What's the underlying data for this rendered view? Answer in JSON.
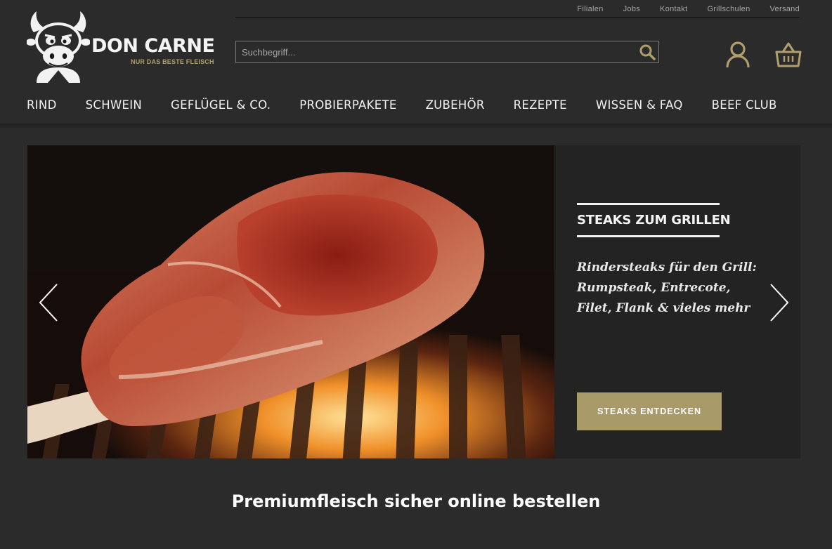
{
  "brand": {
    "name": "DON CARNE",
    "tagline": "NUR DAS BESTE FLEISCH"
  },
  "service_nav": [
    {
      "label": "Filialen"
    },
    {
      "label": "Jobs"
    },
    {
      "label": "Kontakt"
    },
    {
      "label": "Grillschulen"
    },
    {
      "label": "Versand"
    }
  ],
  "search": {
    "placeholder": "Suchbegriff...",
    "value": "",
    "icon": "search-icon"
  },
  "header_icons": {
    "account": "user-icon",
    "cart": "shopping-basket-icon",
    "icon_color": "#b09f6c"
  },
  "main_nav": [
    {
      "label": "RIND"
    },
    {
      "label": "SCHWEIN"
    },
    {
      "label": "GEFLÜGEL & CO."
    },
    {
      "label": "PROBIERPAKETE"
    },
    {
      "label": "ZUBEHÖR"
    },
    {
      "label": "REZEPTE"
    },
    {
      "label": "WISSEN & FAQ"
    },
    {
      "label": "BEEF CLUB"
    }
  ],
  "slider": {
    "slide": {
      "image": "grilled-tomahawk-steak-photo",
      "title": "STEAKS ZUM GRILLEN",
      "text": "Rindersteaks für den Grill: Rumpsteak, Entrecote, Filet, Flank & vieles mehr",
      "cta_label": "STEAKS ENTDECKEN"
    },
    "prev_icon": "chevron-left-icon",
    "next_icon": "chevron-right-icon"
  },
  "headline": "Premiumfleisch sicher online bestellen",
  "colors": {
    "background": "#2b2b2b",
    "accent": "#a99a6a",
    "panel": "#232323"
  }
}
